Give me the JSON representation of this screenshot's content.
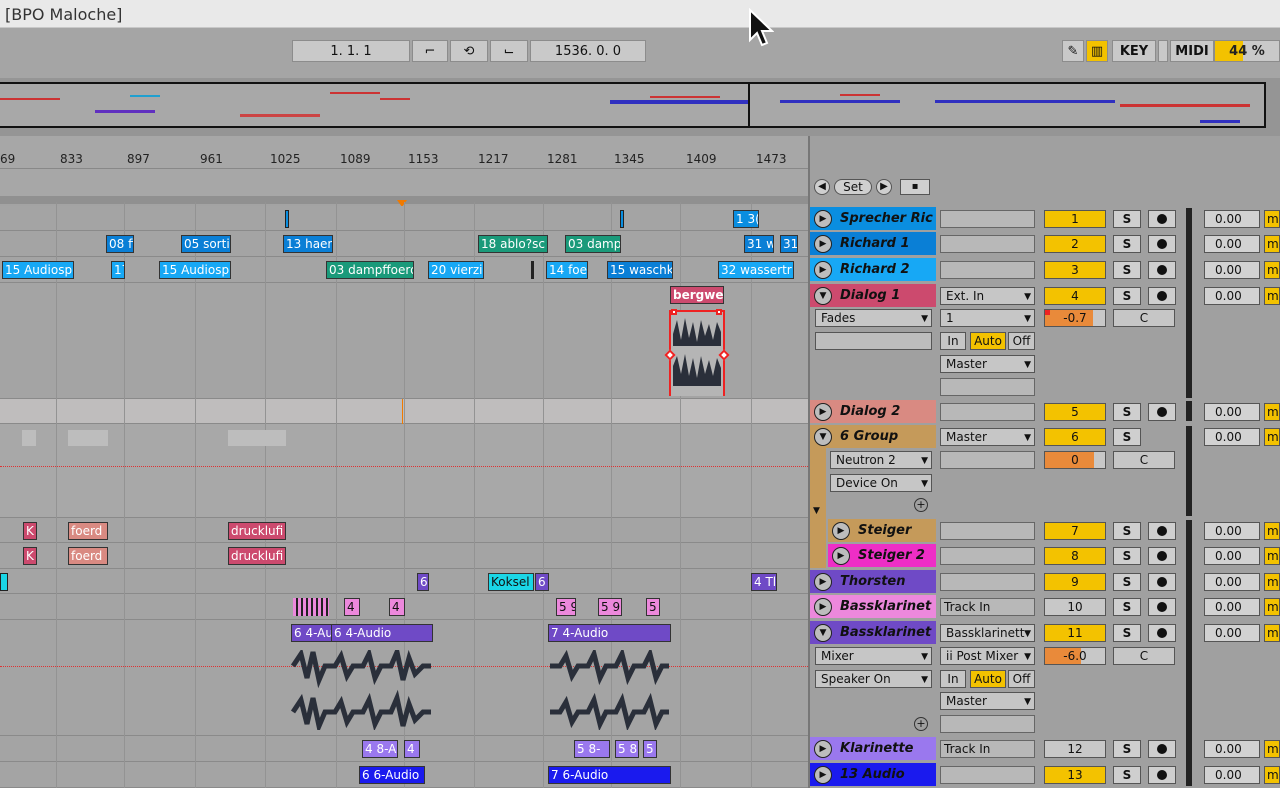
{
  "window": {
    "title": "[BPO Maloche]"
  },
  "transport": {
    "position": "1.   1.   1",
    "loop_length": "1536.   0.   0",
    "key_label": "KEY",
    "midi_label": "MIDI",
    "cpu": "44 %"
  },
  "ruler": {
    "ticks": [
      "69",
      "833",
      "897",
      "961",
      "1025",
      "1089",
      "1153",
      "1217",
      "1281",
      "1345",
      "1409",
      "1473"
    ]
  },
  "locators": {
    "set_label": "Set"
  },
  "tracks": [
    {
      "name": "Sprecher Ric",
      "number": "1",
      "color": "#0a8ee0",
      "vol": "0.00",
      "input": ""
    },
    {
      "name": "Richard 1",
      "number": "2",
      "color": "#0a7fd6",
      "vol": "0.00",
      "input": ""
    },
    {
      "name": "Richard 2",
      "number": "3",
      "color": "#17a8f5",
      "vol": "0.00",
      "input": ""
    },
    {
      "name": "Dialog 1",
      "number": "4",
      "color": "#cc4a6e",
      "vol": "0.00",
      "input": "Ext. In",
      "device": "Fades",
      "channel": "1",
      "pan_value": "-0.7",
      "pan": "C",
      "mon_in": "In",
      "mon_auto": "Auto",
      "mon_off": "Off",
      "out": "Master"
    },
    {
      "name": "Dialog 2",
      "number": "5",
      "color": "#d98a82",
      "vol": "0.00",
      "input": ""
    },
    {
      "name": "6 Group",
      "number": "6",
      "color": "#c59a5a",
      "vol": "0.00",
      "input": "Master",
      "device": "Neutron 2",
      "device_state": "Device On",
      "pan_value": "0",
      "pan": "C"
    },
    {
      "name": "Steiger",
      "number": "7",
      "color": "#c59a5a",
      "vol": "0.00",
      "input": ""
    },
    {
      "name": "Steiger 2",
      "number": "8",
      "color": "#ee2ec6",
      "vol": "0.00",
      "input": ""
    },
    {
      "name": "Thorsten",
      "number": "9",
      "color": "#6f4ac6",
      "vol": "0.00",
      "input": ""
    },
    {
      "name": "Bassklarinet",
      "number": "10",
      "color": "#ec88dc",
      "vol": "0.00",
      "input": "Track In"
    },
    {
      "name": "Bassklarinet",
      "number": "11",
      "color": "#6f4ac6",
      "vol": "0.00",
      "input": "Bassklarinett",
      "device": "Mixer",
      "device_state": "Speaker On",
      "channel": "ii Post Mixer",
      "pan_value": "-6.0",
      "pan": "C",
      "mon_in": "In",
      "mon_auto": "Auto",
      "mon_off": "Off",
      "out": "Master"
    },
    {
      "name": "Klarinette",
      "number": "12",
      "color": "#9a78ee",
      "vol": "0.00",
      "input": "Track In"
    },
    {
      "name": "13 Audio",
      "number": "13",
      "color": "#1a1aee",
      "vol": "0.00",
      "input": ""
    }
  ],
  "clips": {
    "row1": [
      "1 3("
    ],
    "row2": [
      "08 fi",
      "05 sorti",
      "13 haen",
      "18 ablo?sc",
      "03 damp",
      "31 w",
      "31"
    ],
    "row3": [
      "15 Audiosp",
      "17",
      "15 Audiosp",
      "03 dampffoerd",
      "20 vierzi",
      "14 foe",
      "15 waschk",
      "32 wassertr"
    ],
    "row4": [
      "bergwer"
    ],
    "row7": [
      "K",
      "foerd",
      "drucklufi"
    ],
    "row8": [
      "K",
      "foerd",
      "drucklufi"
    ],
    "row9": [
      "6",
      "Koksel",
      "6",
      "4 Tl"
    ],
    "row10": [
      "4",
      "4",
      "5 9",
      "5 9",
      "5"
    ],
    "row11": [
      "6 4-Au",
      "6 4-Audio",
      "7 4-Audio"
    ],
    "row12": [
      "4 8-A",
      "4",
      "5 8-",
      "5 8",
      "5"
    ],
    "row13": [
      "6 6-Audio",
      "7 6-Audio"
    ]
  },
  "letters": {
    "s": "S",
    "m": "m"
  }
}
